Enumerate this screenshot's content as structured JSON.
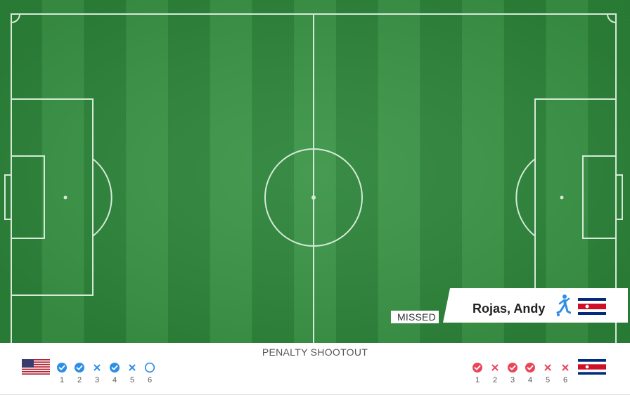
{
  "event": {
    "status": "MISSED",
    "player_name": "Rojas, Andy",
    "kicker_icon": "kicking-player-icon",
    "team_flag": "costa-rica-flag"
  },
  "shootout": {
    "title": "PENALTY SHOOTOUT",
    "home": {
      "flag": "usa-flag",
      "color": "#2d8ee6",
      "kicks": [
        {
          "num": "1",
          "result": "scored"
        },
        {
          "num": "2",
          "result": "scored"
        },
        {
          "num": "3",
          "result": "missed"
        },
        {
          "num": "4",
          "result": "scored"
        },
        {
          "num": "5",
          "result": "missed"
        },
        {
          "num": "6",
          "result": "pending"
        }
      ]
    },
    "away": {
      "flag": "costa-rica-flag",
      "color": "#e8475a",
      "kicks": [
        {
          "num": "1",
          "result": "scored"
        },
        {
          "num": "2",
          "result": "missed"
        },
        {
          "num": "3",
          "result": "scored"
        },
        {
          "num": "4",
          "result": "scored"
        },
        {
          "num": "5",
          "result": "missed"
        },
        {
          "num": "6",
          "result": "missed"
        }
      ]
    }
  },
  "colors": {
    "pitch_light": "#3a9446",
    "pitch_dark": "#2c8439",
    "line": "#d4ead6"
  }
}
